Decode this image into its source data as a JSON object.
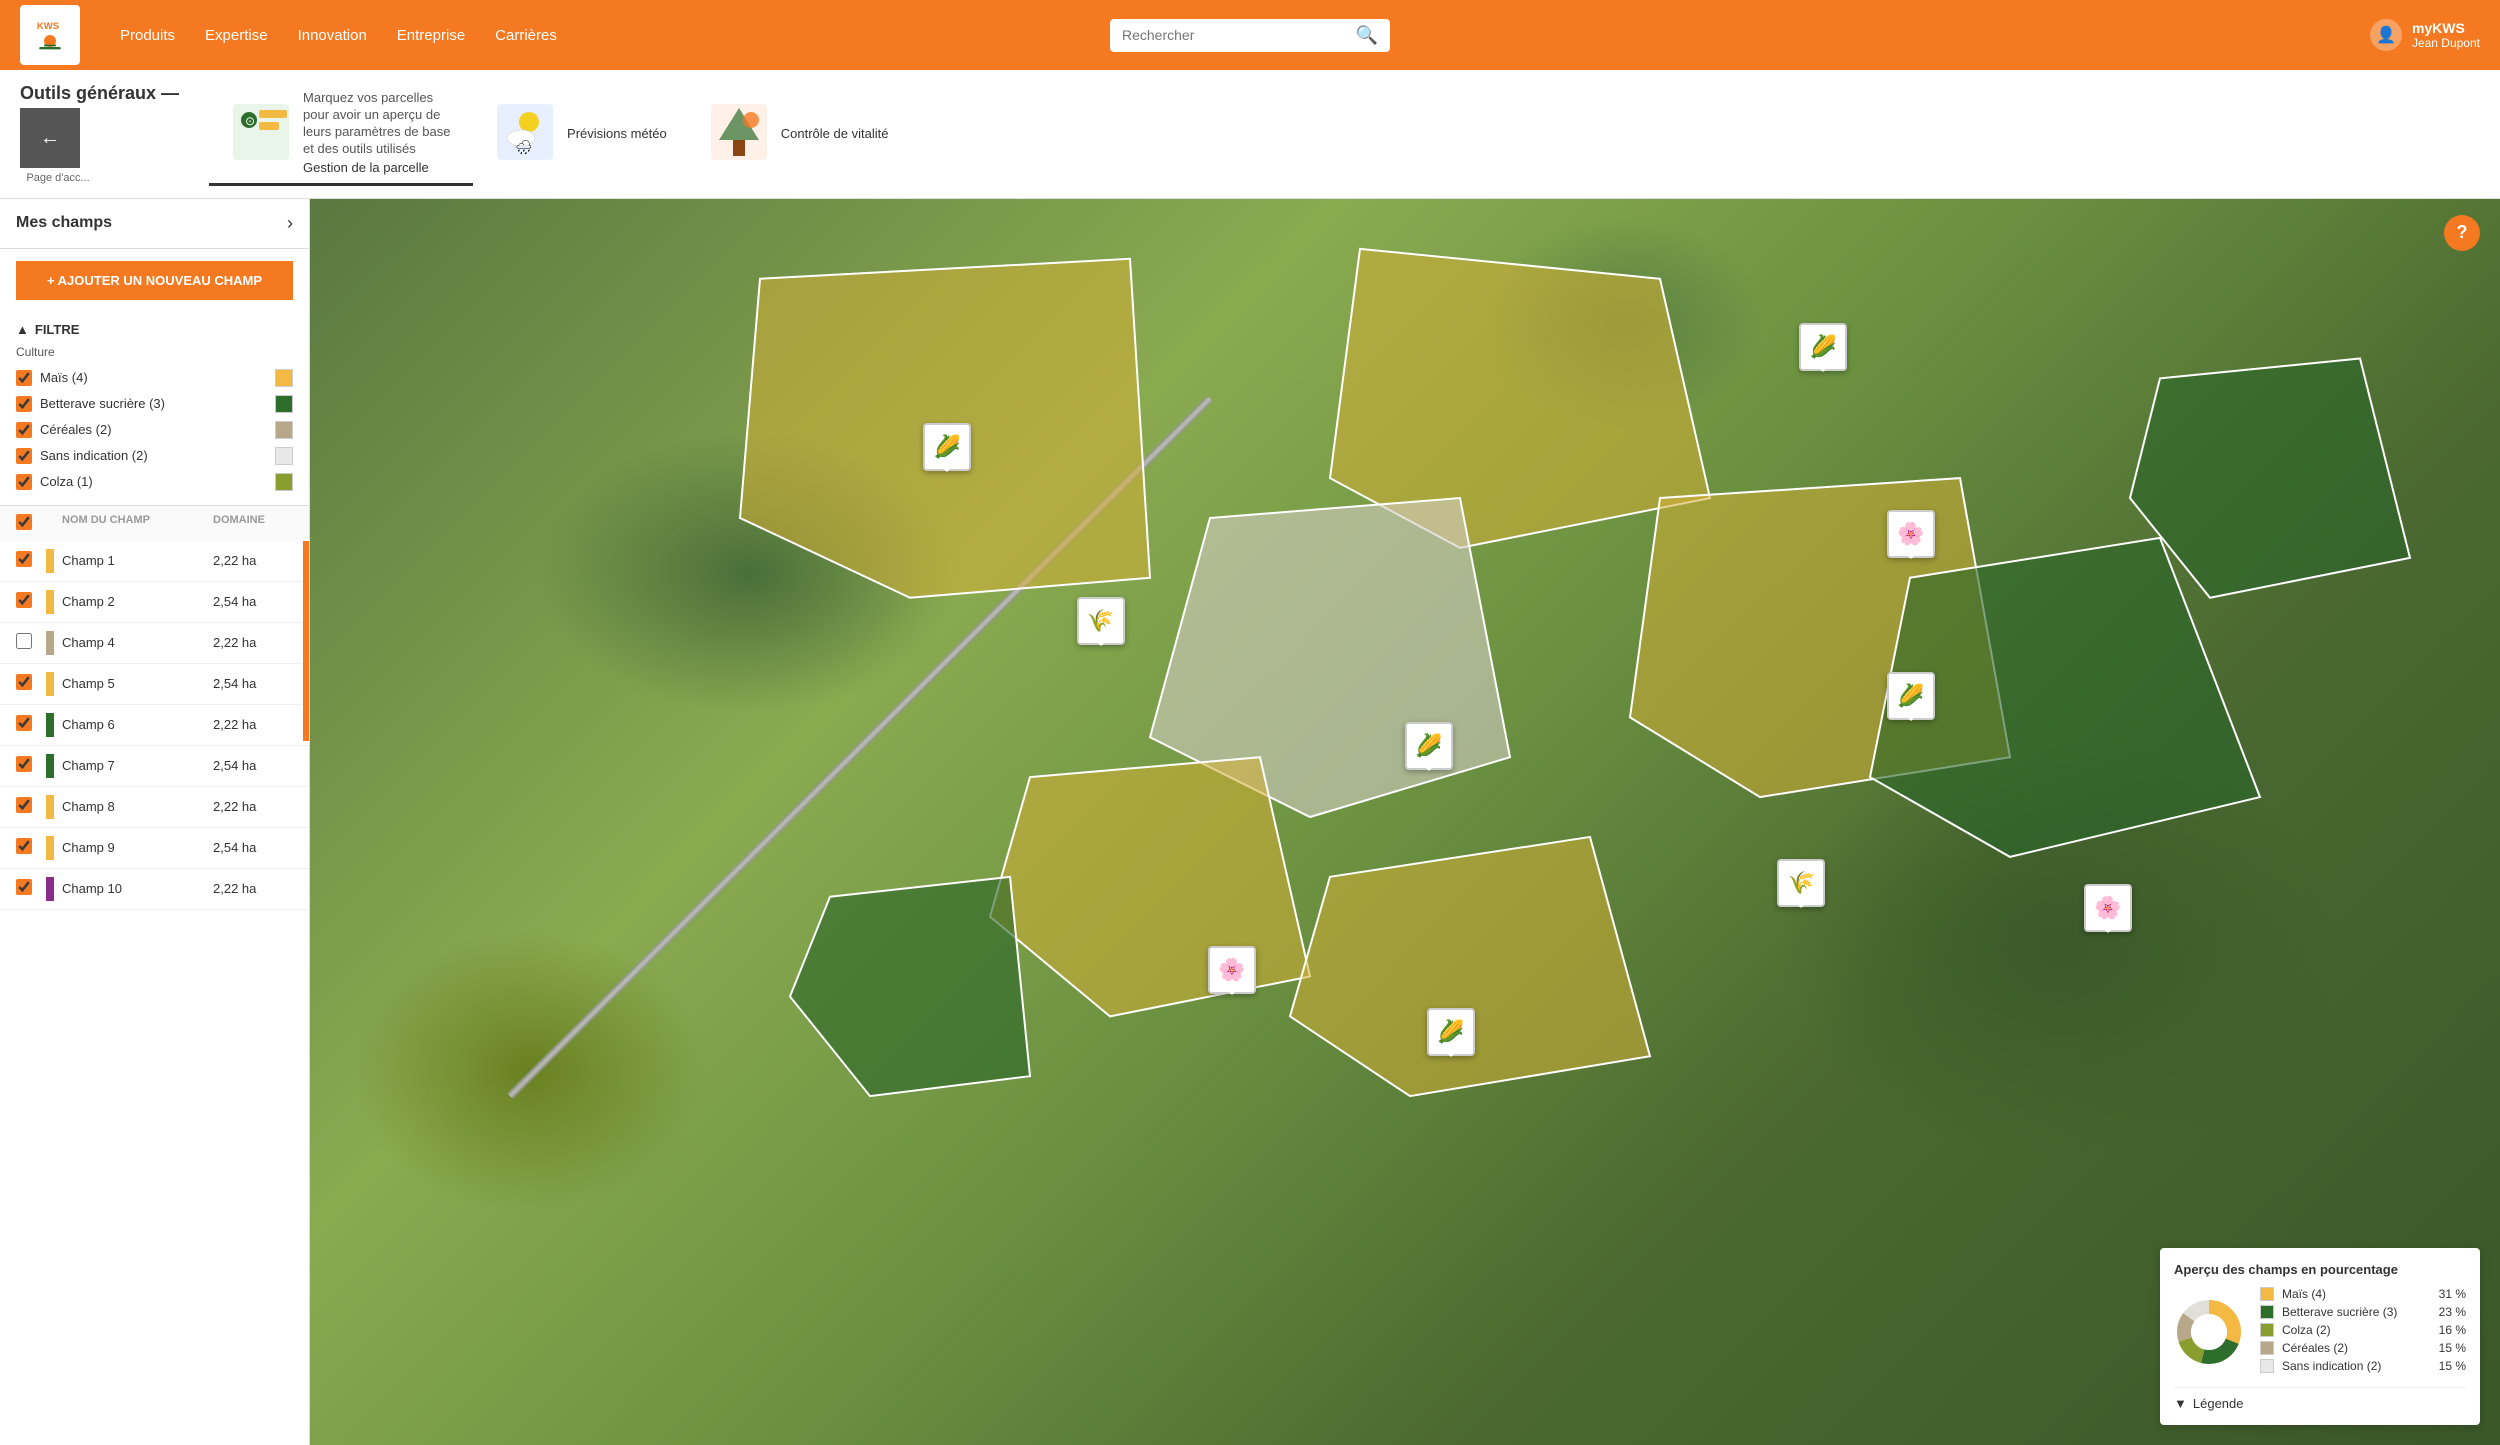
{
  "nav": {
    "logo_text": "KWS",
    "links": [
      "Produits",
      "Expertise",
      "Innovation",
      "Entreprise",
      "Carrières"
    ],
    "search_placeholder": "Rechercher",
    "user_name": "myKWS",
    "user_sub": "Jean Dupont"
  },
  "toolbar": {
    "section_title": "Outils généraux —",
    "back_label": "←",
    "back_page": "Page d'acc...",
    "tools": [
      {
        "id": "gestion",
        "label": "Gestion de la parcelle",
        "desc": "Marquez vos parcelles pour avoir un aperçu de leurs paramètres de base et des outils utilisés",
        "active": true
      },
      {
        "id": "meteo",
        "label": "Prévisions météo",
        "desc": "",
        "active": false
      },
      {
        "id": "vitalite",
        "label": "Contrôle de vitalité",
        "desc": "",
        "active": false
      }
    ]
  },
  "sidebar": {
    "title": "Mes champs",
    "add_btn": "+ AJOUTER UN NOUVEAU CHAMP",
    "filter": {
      "label": "FILTRE",
      "culture_label": "Culture",
      "items": [
        {
          "name": "Maïs (4)",
          "checked": true,
          "color": "#f4b942"
        },
        {
          "name": "Betterave sucrière (3)",
          "checked": true,
          "color": "#2d6e2d"
        },
        {
          "name": "Céréales (2)",
          "checked": true,
          "color": "#b8a88a"
        },
        {
          "name": "Sans indication (2)",
          "checked": true,
          "color": "#e8e8e8"
        },
        {
          "name": "Colza  (1)",
          "checked": true,
          "color": "#8a9e30"
        }
      ]
    },
    "table": {
      "col_name": "NOM DU CHAMP",
      "col_domain": "DOMAINE",
      "rows": [
        {
          "name": "Champ 1",
          "domain": "2,22 ha",
          "checked": true,
          "color_class": "bar-yellow"
        },
        {
          "name": "Champ 2",
          "domain": "2,54 ha",
          "checked": true,
          "color_class": "bar-yellow"
        },
        {
          "name": "Champ 4",
          "domain": "2,22 ha",
          "checked": false,
          "color_class": "bar-tan"
        },
        {
          "name": "Champ 5",
          "domain": "2,54 ha",
          "checked": true,
          "color_class": "bar-yellow"
        },
        {
          "name": "Champ 6",
          "domain": "2,22 ha",
          "checked": true,
          "color_class": "bar-green-dark"
        },
        {
          "name": "Champ 7",
          "domain": "2,54 ha",
          "checked": true,
          "color_class": "bar-green-dark"
        },
        {
          "name": "Champ 8",
          "domain": "2,22 ha",
          "checked": true,
          "color_class": "bar-yellow"
        },
        {
          "name": "Champ 9",
          "domain": "2,54 ha",
          "checked": true,
          "color_class": "bar-yellow"
        },
        {
          "name": "Champ 10",
          "domain": "2,22 ha",
          "checked": true,
          "color_class": "bar-purple"
        }
      ]
    }
  },
  "map": {
    "help_label": "?",
    "icons": [
      {
        "top": "18%",
        "left": "28%",
        "symbol": "🌽",
        "type": "sunflower"
      },
      {
        "top": "10%",
        "left": "68%",
        "symbol": "🌽",
        "type": "corn"
      },
      {
        "top": "25%",
        "left": "72%",
        "symbol": "🌸",
        "type": "flower"
      },
      {
        "top": "32%",
        "left": "35%",
        "symbol": "🌾",
        "type": "grain"
      },
      {
        "top": "42%",
        "left": "50%",
        "symbol": "🌽",
        "type": "corn"
      },
      {
        "top": "38%",
        "left": "72%",
        "symbol": "🌽",
        "type": "corn-2"
      },
      {
        "top": "53%",
        "left": "67%",
        "symbol": "🌾",
        "type": "grain-2"
      },
      {
        "top": "60%",
        "left": "41%",
        "symbol": "🌸",
        "type": "flower-2"
      },
      {
        "top": "65%",
        "left": "51%",
        "symbol": "🌽",
        "type": "corn-3"
      },
      {
        "top": "55%",
        "left": "81%",
        "symbol": "🌸",
        "type": "flower-3"
      }
    ]
  },
  "legend": {
    "title": "Aperçu des champs en pourcentage",
    "items": [
      {
        "label": "Maïs (4)",
        "pct": "31 %",
        "color": "#f4b942"
      },
      {
        "label": "Betterave sucrière (3)",
        "pct": "23 %",
        "color": "#2d6e2d"
      },
      {
        "label": "Colza (2)",
        "pct": "16 %",
        "color": "#8a9e30"
      },
      {
        "label": "Céréales (2)",
        "pct": "15 %",
        "color": "#b8a88a"
      },
      {
        "label": "Sans indication (2)",
        "pct": "15 %",
        "color": "#e8e8e8"
      }
    ],
    "footer_label": "Légende",
    "donut": {
      "segments": [
        {
          "pct": 31,
          "color": "#f4b942"
        },
        {
          "pct": 23,
          "color": "#2d6e2d"
        },
        {
          "pct": 16,
          "color": "#8a9e30"
        },
        {
          "pct": 15,
          "color": "#b8a88a"
        },
        {
          "pct": 15,
          "color": "#e8e8e8"
        }
      ]
    }
  }
}
